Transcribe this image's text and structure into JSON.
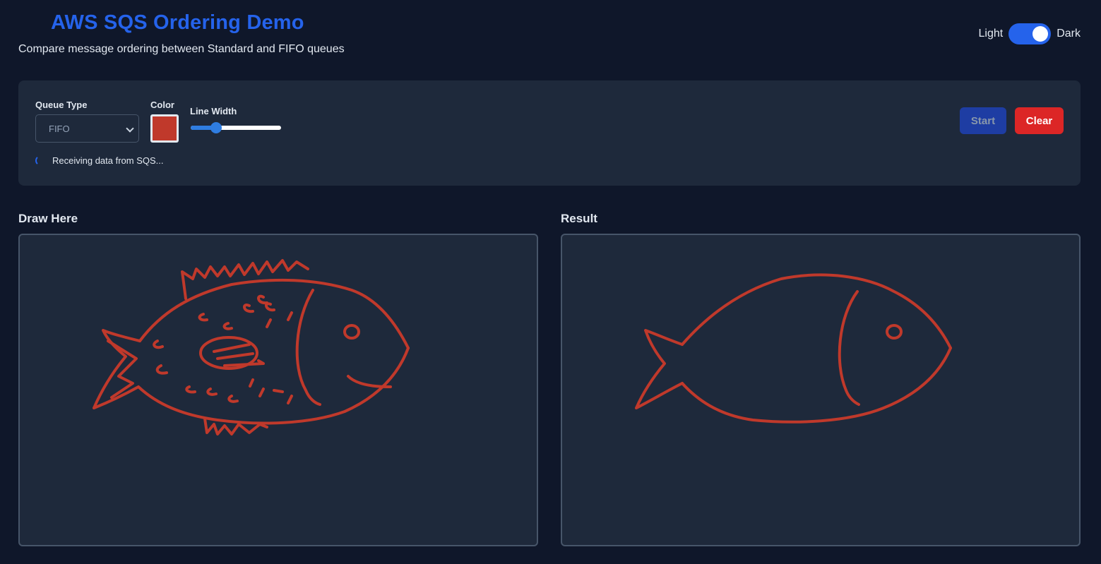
{
  "header": {
    "title": "AWS SQS Ordering Demo",
    "subtitle": "Compare message ordering between Standard and FIFO queues"
  },
  "theme": {
    "light_label": "Light",
    "dark_label": "Dark",
    "selected": "Dark"
  },
  "controls": {
    "queue_type_label": "Queue Type",
    "queue_type_value": "FIFO",
    "color_label": "Color",
    "color_value": "#c0392b",
    "line_width_label": "Line Width",
    "line_width_fraction": 0.25,
    "status_text": "Receiving data from SQS...",
    "start_label": "Start",
    "clear_label": "Clear"
  },
  "canvases": {
    "draw_label": "Draw Here",
    "result_label": "Result",
    "stroke_color": "#c0392b"
  }
}
